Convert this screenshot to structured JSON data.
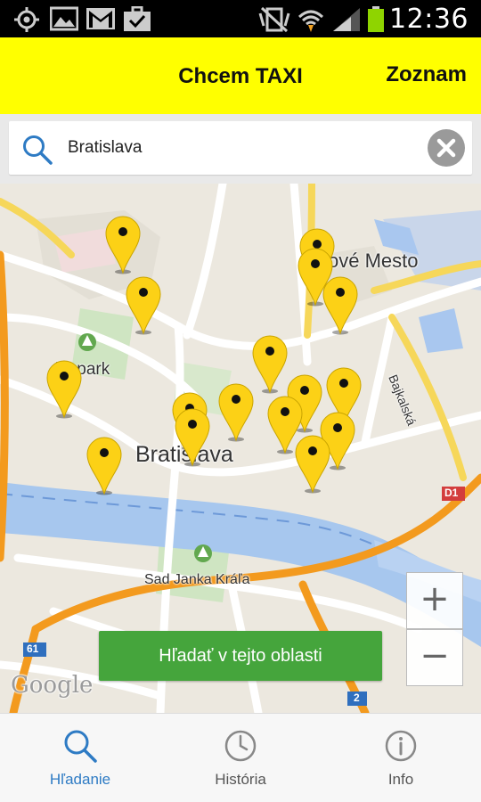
{
  "status_bar": {
    "time": "12:36",
    "icons": [
      "gps-icon",
      "gallery-icon",
      "gmail-icon",
      "briefcase-icon",
      "vibrate-icon",
      "wifi-icon",
      "signal-icon",
      "battery-icon"
    ]
  },
  "app_bar": {
    "title": "Chcem TAXI",
    "list_label": "Zoznam",
    "color": "#ffff00"
  },
  "search": {
    "value": "Bratislava"
  },
  "map": {
    "labels": {
      "district": "ové Mesto",
      "park": "ký park",
      "city": "Bratislava",
      "bridge": "Sad Janka Kráľa",
      "street": "Bajkalská",
      "route_d1": "D1",
      "route_61": "61",
      "route_2": "2",
      "google": "Google"
    },
    "taxi_pin_color": "#fcd116",
    "zoom_in": "+",
    "zoom_out": "−"
  },
  "search_area_button": {
    "label": "Hľadať v tejto oblasti",
    "color": "#45a53c"
  },
  "bottom_nav": {
    "items": [
      {
        "label": "Hľadanie",
        "icon": "search-icon",
        "active": true
      },
      {
        "label": "História",
        "icon": "clock-icon",
        "active": false
      },
      {
        "label": "Info",
        "icon": "info-icon",
        "active": false
      }
    ],
    "active_color": "#2e7bc4"
  }
}
